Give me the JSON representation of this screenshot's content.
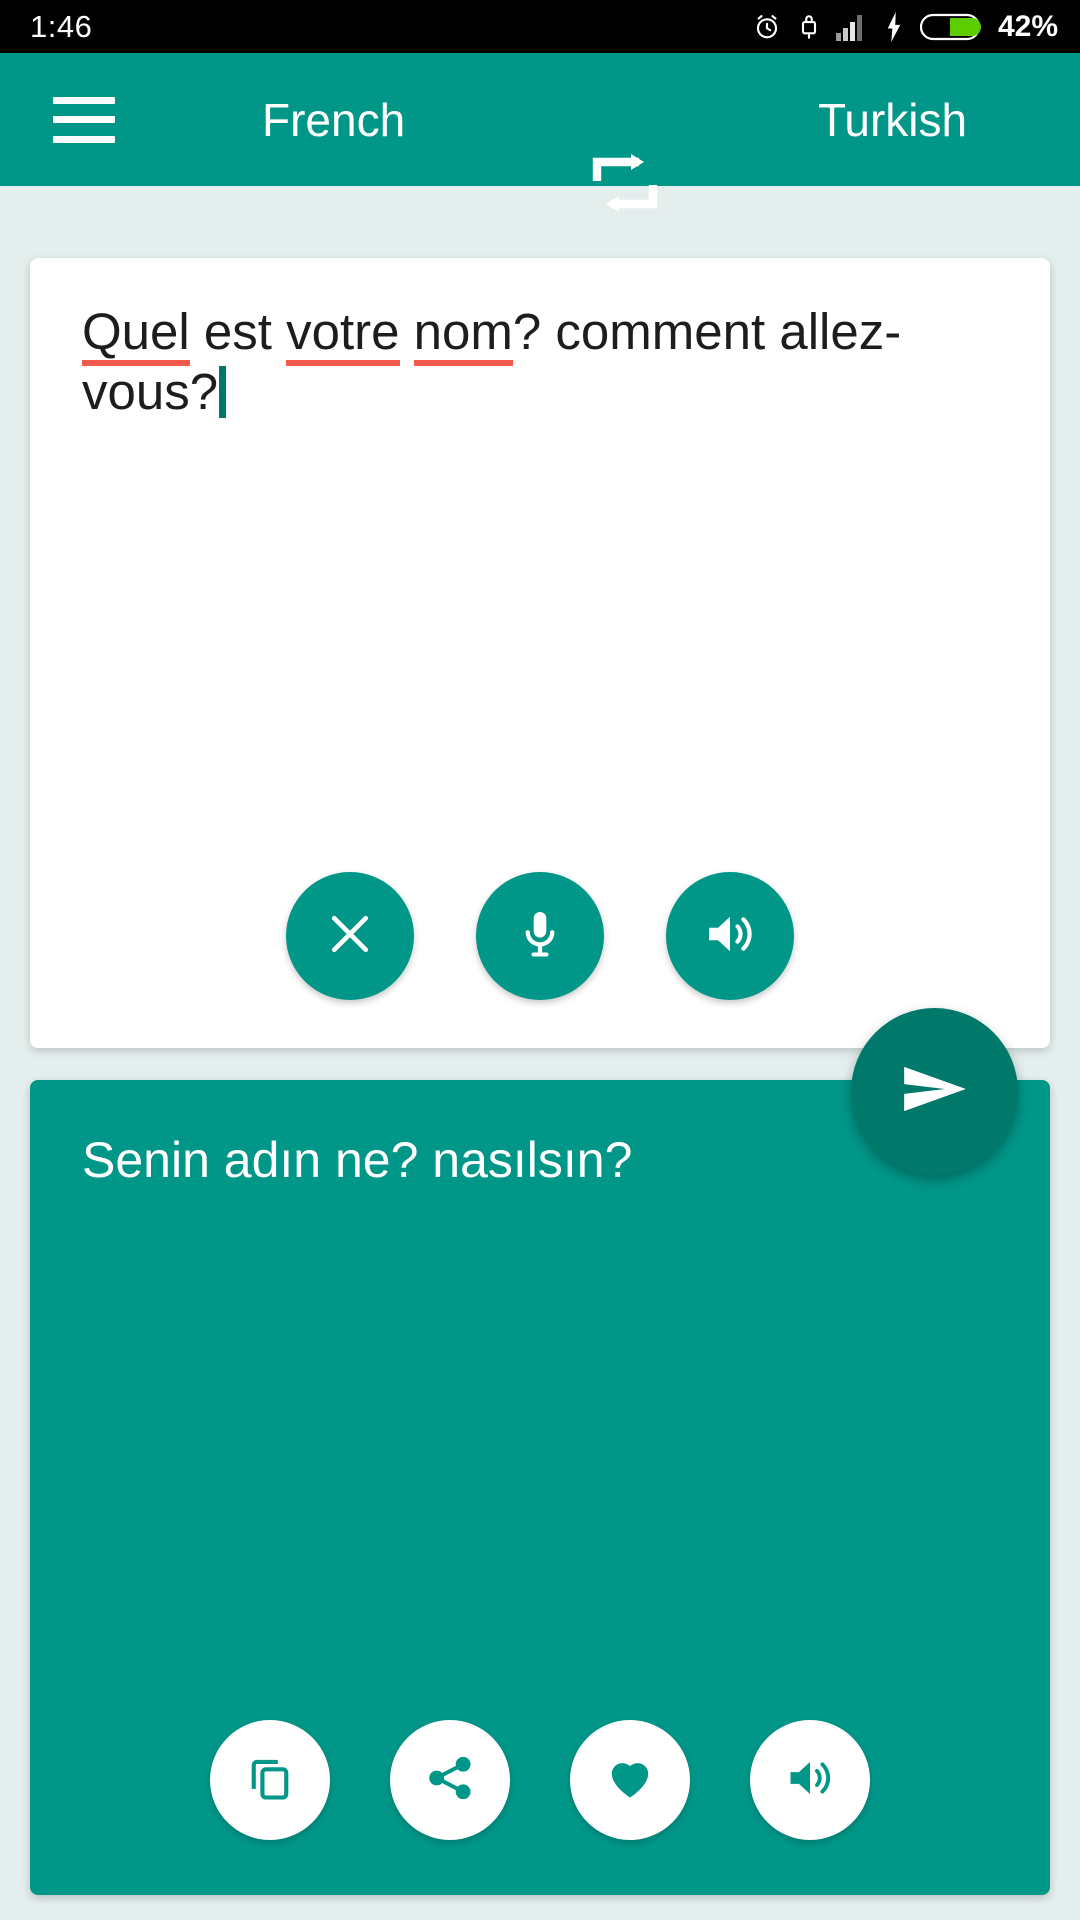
{
  "status_bar": {
    "time": "1:46",
    "battery_percent": "42%",
    "icons": [
      "alarm-clock-icon",
      "usb-lock-icon",
      "signal-bars-icon",
      "charging-bolt-icon",
      "battery-icon"
    ]
  },
  "app_bar": {
    "menu_icon": "hamburger-menu-icon",
    "source_language": "French",
    "swap_icon": "swap-languages-icon",
    "target_language": "Turkish"
  },
  "source_panel": {
    "text_segments": [
      {
        "text": "Quel",
        "misspelled": true
      },
      {
        "text": " est ",
        "misspelled": false
      },
      {
        "text": "votre",
        "misspelled": true
      },
      {
        "text": " ",
        "misspelled": false
      },
      {
        "text": "nom",
        "misspelled": true
      },
      {
        "text": "? comment ",
        "misspelled": false
      },
      {
        "text": "allez-vous",
        "misspelled": true
      },
      {
        "text": "?",
        "misspelled": false
      }
    ],
    "full_text": "Quel est votre nom? comment allez-vous?",
    "cursor_visible": true,
    "actions": [
      {
        "name": "clear-button",
        "icon": "close-x-icon",
        "label": "Clear"
      },
      {
        "name": "microphone-button",
        "icon": "microphone-icon",
        "label": "Speak"
      },
      {
        "name": "speak-source-button",
        "icon": "speaker-icon",
        "label": "Listen"
      }
    ]
  },
  "send_button": {
    "icon": "send-icon",
    "label": "Translate"
  },
  "target_panel": {
    "translated_text": "Senin adın ne? nasılsın?",
    "actions": [
      {
        "name": "copy-button",
        "icon": "copy-icon",
        "label": "Copy"
      },
      {
        "name": "share-button",
        "icon": "share-icon",
        "label": "Share"
      },
      {
        "name": "favorite-button",
        "icon": "heart-icon",
        "label": "Favorite"
      },
      {
        "name": "speak-target-button",
        "icon": "speaker-icon",
        "label": "Listen"
      }
    ]
  },
  "colors": {
    "primary": "#009688",
    "primary_dark": "#00796b",
    "background": "#e4efed",
    "status_bar": "#000000",
    "spellcheck_underline": "#f2594b",
    "battery_fill": "#5ecd00",
    "card_white": "#ffffff"
  }
}
